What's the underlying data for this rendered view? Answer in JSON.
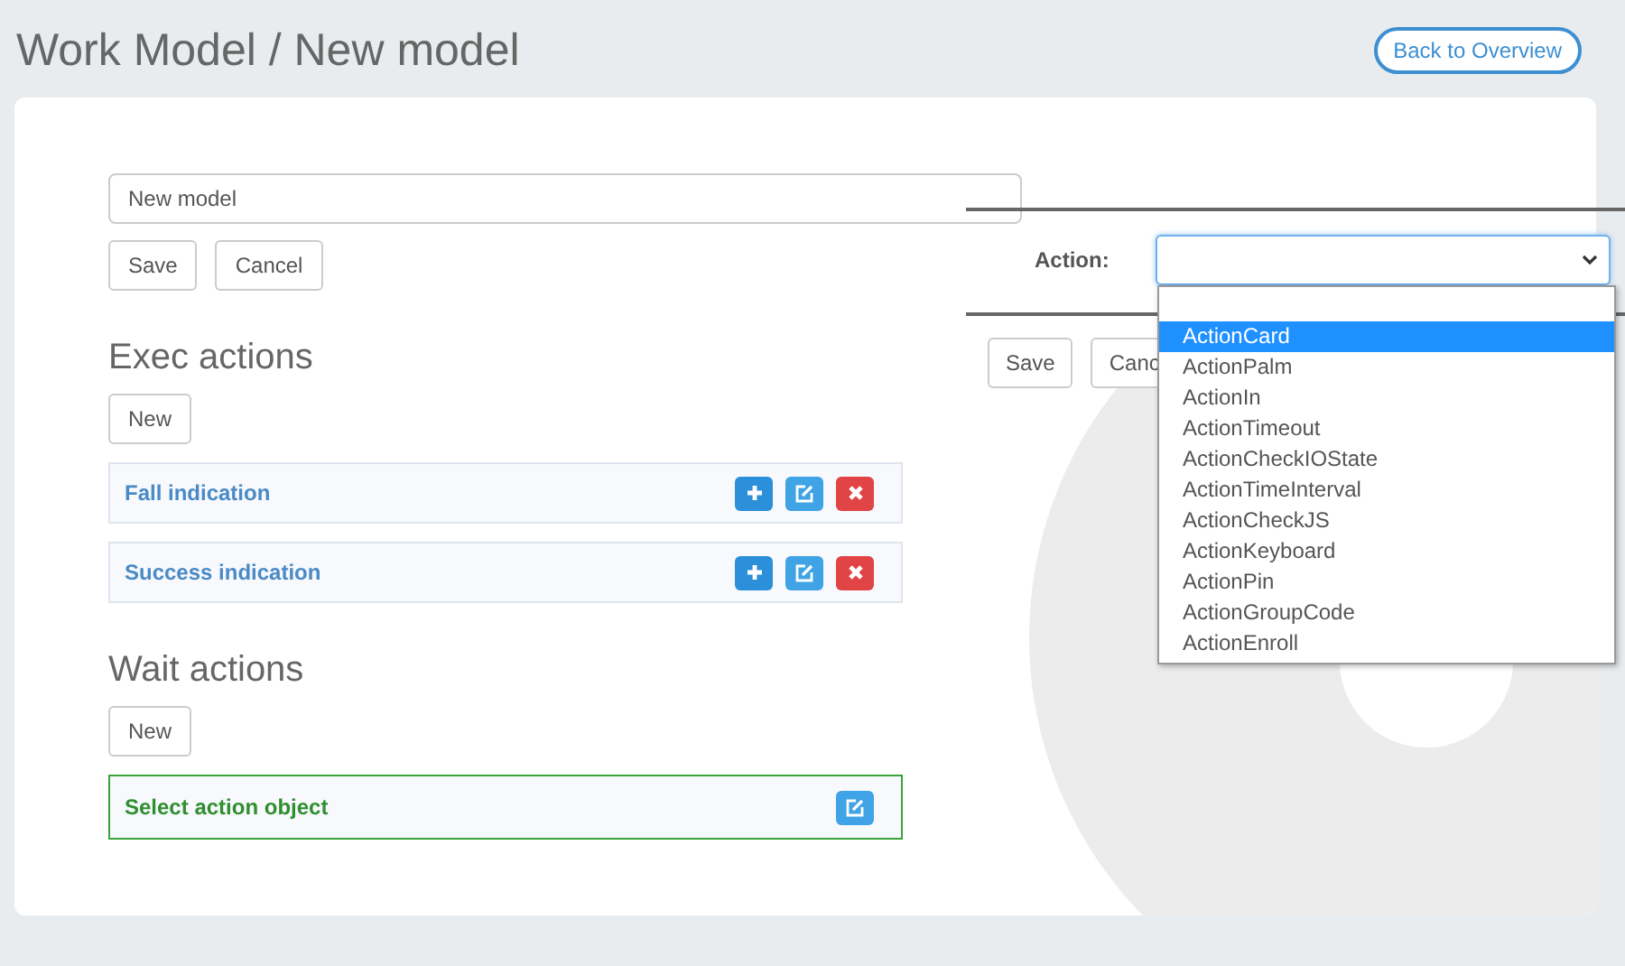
{
  "header": {
    "title": "Work Model / New model",
    "back_button": "Back to Overview"
  },
  "name_field": {
    "value": "New model"
  },
  "form_buttons": [
    "Save",
    "Cancel"
  ],
  "sections": [
    {
      "heading": "Exec actions",
      "new_button": "New",
      "items": [
        {
          "label": "Fall indication",
          "highlighted": false,
          "can_add": true,
          "can_edit": true,
          "can_delete": true
        },
        {
          "label": "Success indication",
          "highlighted": false,
          "can_add": true,
          "can_edit": true,
          "can_delete": true
        }
      ]
    },
    {
      "heading": "Wait actions",
      "new_button": "New",
      "items": [
        {
          "label": "Select action object",
          "highlighted": true,
          "can_add": false,
          "can_edit": true,
          "can_delete": false
        }
      ]
    }
  ],
  "action_panel": {
    "label": "Action:",
    "buttons": [
      "Save",
      "Canc"
    ],
    "options": [
      {
        "label": "ActionCard",
        "selected": true
      },
      {
        "label": "ActionPalm",
        "selected": false
      },
      {
        "label": "ActionIn",
        "selected": false
      },
      {
        "label": "ActionTimeout",
        "selected": false
      },
      {
        "label": "ActionCheckIOState",
        "selected": false
      },
      {
        "label": "ActionTimeInterval",
        "selected": false
      },
      {
        "label": "ActionCheckJS",
        "selected": false
      },
      {
        "label": "ActionKeyboard",
        "selected": false
      },
      {
        "label": "ActionPin",
        "selected": false
      },
      {
        "label": "ActionGroupCode",
        "selected": false
      },
      {
        "label": "ActionEnroll",
        "selected": false
      }
    ]
  }
}
